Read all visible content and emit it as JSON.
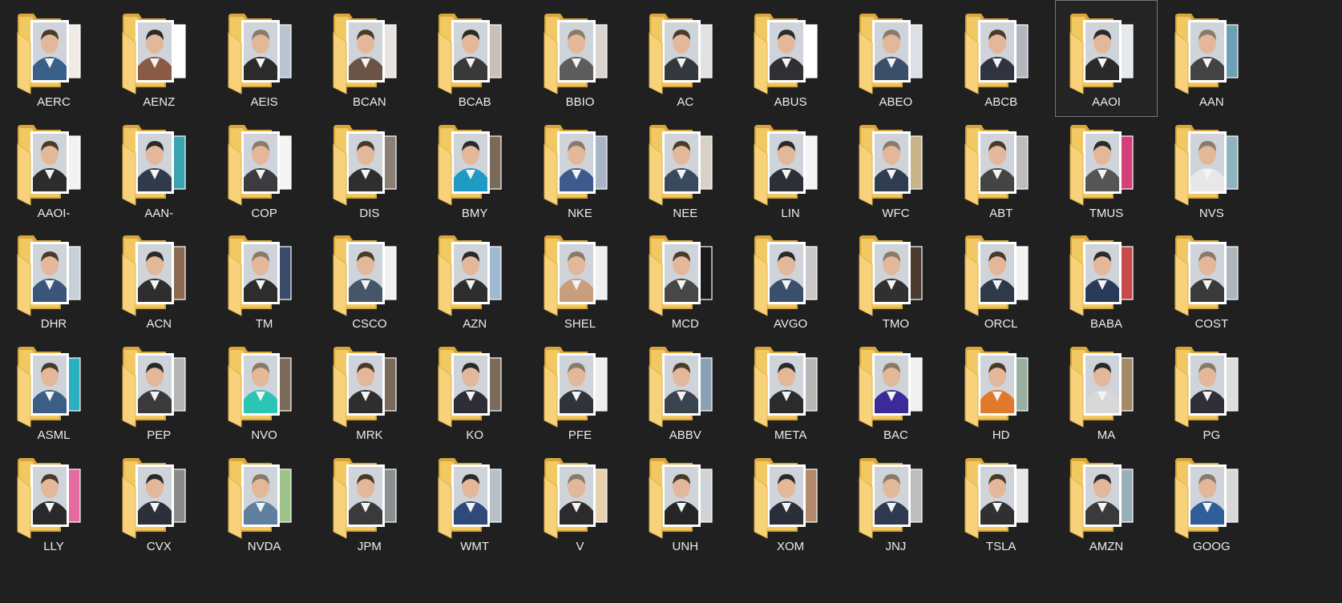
{
  "explorer": {
    "selected": "AAOI",
    "folders": [
      {
        "name": "AERC",
        "palette": [
          "#3a5f8a",
          "#f0ebe5"
        ]
      },
      {
        "name": "AENZ",
        "palette": [
          "#8a5a44",
          "#ffffff"
        ]
      },
      {
        "name": "AEIS",
        "palette": [
          "#2b2b2b",
          "#b8c4d2"
        ]
      },
      {
        "name": "BCAN",
        "palette": [
          "#6b5446",
          "#e9e4df"
        ]
      },
      {
        "name": "BCAB",
        "palette": [
          "#393939",
          "#c9c1b5"
        ]
      },
      {
        "name": "BBIO",
        "palette": [
          "#5c5c5c",
          "#d9d4cf"
        ]
      },
      {
        "name": "AC",
        "palette": [
          "#33383f",
          "#e2e2e2"
        ]
      },
      {
        "name": "ABUS",
        "palette": [
          "#2f2f34",
          "#ffffff"
        ]
      },
      {
        "name": "ABEO",
        "palette": [
          "#3b4f6b",
          "#dcdfe3"
        ]
      },
      {
        "name": "ABCB",
        "palette": [
          "#2f3440",
          "#b1b7bd"
        ]
      },
      {
        "name": "AAOI",
        "palette": [
          "#2a2a2a",
          "#e6e9ed"
        ]
      },
      {
        "name": "AAN",
        "palette": [
          "#434343",
          "#6ea0b5"
        ]
      },
      {
        "name": "AAOI-",
        "palette": [
          "#2c2c2c",
          "#f2f2f2"
        ]
      },
      {
        "name": "AAN-",
        "palette": [
          "#2f3a4c",
          "#3aa3b0"
        ]
      },
      {
        "name": "COP",
        "palette": [
          "#3b3b40",
          "#f5f5f5"
        ]
      },
      {
        "name": "DIS",
        "palette": [
          "#2e2e2e",
          "#8a7f74"
        ]
      },
      {
        "name": "BMY",
        "palette": [
          "#1f9ac4",
          "#7a6a5a"
        ]
      },
      {
        "name": "NKE",
        "palette": [
          "#3c5a8c",
          "#a9b5c6"
        ]
      },
      {
        "name": "NEE",
        "palette": [
          "#394a5e",
          "#d8d1c8"
        ]
      },
      {
        "name": "LIN",
        "palette": [
          "#2b2f36",
          "#f4f4f4"
        ]
      },
      {
        "name": "WFC",
        "palette": [
          "#2f3c52",
          "#c8b48a"
        ]
      },
      {
        "name": "ABT",
        "palette": [
          "#444444",
          "#bdbdbd"
        ]
      },
      {
        "name": "TMUS",
        "palette": [
          "#555555",
          "#d6407a"
        ]
      },
      {
        "name": "NVS",
        "palette": [
          "#e8e8e8",
          "#8fb4c0"
        ]
      },
      {
        "name": "DHR",
        "palette": [
          "#3a557a",
          "#c7cfd8"
        ]
      },
      {
        "name": "ACN",
        "palette": [
          "#2e2e2e",
          "#8c6a52"
        ]
      },
      {
        "name": "TM",
        "palette": [
          "#2d2d2d",
          "#3a4a6a"
        ]
      },
      {
        "name": "CSCO",
        "palette": [
          "#465568",
          "#f0f0f0"
        ]
      },
      {
        "name": "AZN",
        "palette": [
          "#2d2d2d",
          "#9fb9d1"
        ]
      },
      {
        "name": "SHEL",
        "palette": [
          "#c99e7d",
          "#f0f0f0"
        ]
      },
      {
        "name": "MCD",
        "palette": [
          "#474747",
          "#1a1a1a"
        ]
      },
      {
        "name": "AVGO",
        "palette": [
          "#3a4f6e",
          "#c9c9c9"
        ]
      },
      {
        "name": "TMO",
        "palette": [
          "#303030",
          "#4a3a30"
        ]
      },
      {
        "name": "ORCL",
        "palette": [
          "#2f3a48",
          "#f2f2f2"
        ]
      },
      {
        "name": "BABA",
        "palette": [
          "#2a3a5a",
          "#c84a4a"
        ]
      },
      {
        "name": "COST",
        "palette": [
          "#3a3a3a",
          "#aeb6bd"
        ]
      },
      {
        "name": "ASML",
        "palette": [
          "#3a5e86",
          "#2ab0c0"
        ]
      },
      {
        "name": "PEP",
        "palette": [
          "#3a3a3a",
          "#b5b5b5"
        ]
      },
      {
        "name": "NVO",
        "palette": [
          "#2cc4b4",
          "#7a6a5a"
        ]
      },
      {
        "name": "MRK",
        "palette": [
          "#2e2e2e",
          "#7a6a5a"
        ]
      },
      {
        "name": "KO",
        "palette": [
          "#2d2d38",
          "#7a6b5c"
        ]
      },
      {
        "name": "PFE",
        "palette": [
          "#30343a",
          "#efefef"
        ]
      },
      {
        "name": "ABBV",
        "palette": [
          "#3a4350",
          "#8aa0b4"
        ]
      },
      {
        "name": "META",
        "palette": [
          "#2b2b2b",
          "#b7b7b7"
        ]
      },
      {
        "name": "BAC",
        "palette": [
          "#3b2a9a",
          "#f0f0f0"
        ]
      },
      {
        "name": "HD",
        "palette": [
          "#e07a2a",
          "#9ab0a0"
        ]
      },
      {
        "name": "MA",
        "palette": [
          "#d8d8d8",
          "#a58a6a"
        ]
      },
      {
        "name": "PG",
        "palette": [
          "#2f2f3a",
          "#dedede"
        ]
      },
      {
        "name": "LLY",
        "palette": [
          "#2a2a2a",
          "#e56aa0"
        ]
      },
      {
        "name": "CVX",
        "palette": [
          "#2b2f3a",
          "#8a8a8a"
        ]
      },
      {
        "name": "NVDA",
        "palette": [
          "#5f7fa0",
          "#9ec38a"
        ]
      },
      {
        "name": "JPM",
        "palette": [
          "#3a3a3a",
          "#8a8f92"
        ]
      },
      {
        "name": "WMT",
        "palette": [
          "#2e4a7a",
          "#b8c0c8"
        ]
      },
      {
        "name": "V",
        "palette": [
          "#2b2b2b",
          "#e7d2b0"
        ]
      },
      {
        "name": "UNH",
        "palette": [
          "#262626",
          "#d0d4d8"
        ]
      },
      {
        "name": "XOM",
        "palette": [
          "#2a2e38",
          "#b08a6a"
        ]
      },
      {
        "name": "JNJ",
        "palette": [
          "#2f3a52",
          "#bdbdbd"
        ]
      },
      {
        "name": "TSLA",
        "palette": [
          "#303030",
          "#e8e8e8"
        ]
      },
      {
        "name": "AMZN",
        "palette": [
          "#3a3a3a",
          "#9ab0b8"
        ]
      },
      {
        "name": "GOOG",
        "palette": [
          "#2f5e9a",
          "#d8d8d8"
        ]
      }
    ]
  }
}
